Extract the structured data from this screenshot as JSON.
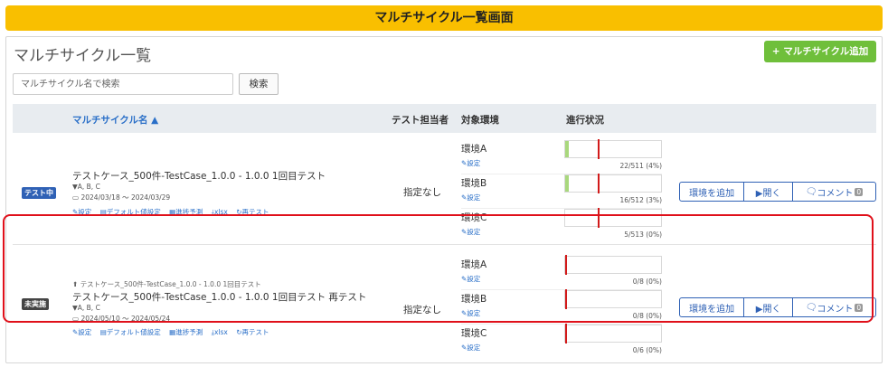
{
  "banner": {
    "title": "マルチサイクル一覧画面"
  },
  "panel": {
    "title": "マルチサイクル一覧",
    "add_button": "+ マルチサイクル追加",
    "search_placeholder": "マルチサイクル名で検索",
    "search_button": "検索"
  },
  "table": {
    "headers": {
      "name": "マルチサイクル名 ▲",
      "assignee": "テスト担当者",
      "env": "対象環境",
      "progress": "進行状況"
    },
    "rows": [
      {
        "status": "テスト中",
        "status_color": "#2f61b5",
        "parent": "",
        "name": "テストケース_500件-TestCase_1.0.0 - 1.0.0 1回目テスト",
        "filter": "▼A, B, C",
        "dates": "2024/03/18 ～ 2024/03/29",
        "links": [
          "設定",
          "デフォルト値設定",
          "進捗予測",
          "xlsx",
          "再テスト"
        ],
        "assignee": "指定なし",
        "envs": [
          {
            "name": "環境A",
            "setting": "設定",
            "progress": "22/511 (4%)",
            "ratio": 0.04
          },
          {
            "name": "環境B",
            "setting": "設定",
            "progress": "16/512 (3%)",
            "ratio": 0.03
          },
          {
            "name": "環境C",
            "setting": "設定",
            "progress": "5/513 (0%)",
            "ratio": 0.0
          }
        ],
        "actions": {
          "add_env": "環境を追加",
          "open": "▶開く",
          "comment": "コメント",
          "comment_count": "0"
        }
      },
      {
        "status": "未実施",
        "status_color": "#444444",
        "parent": "テストケース_500件-TestCase_1.0.0 - 1.0.0 1回目テスト",
        "name": "テストケース_500件-TestCase_1.0.0 - 1.0.0 1回目テスト 再テスト",
        "filter": "▼A, B, C",
        "dates": "2024/05/10 ～ 2024/05/24",
        "links": [
          "設定",
          "デフォルト値設定",
          "進捗予測",
          "xlsx",
          "再テスト"
        ],
        "assignee": "指定なし",
        "envs": [
          {
            "name": "環境A",
            "setting": "設定",
            "progress": "0/8 (0%)",
            "ratio": 0.0
          },
          {
            "name": "環境B",
            "setting": "設定",
            "progress": "0/8 (0%)",
            "ratio": 0.0
          },
          {
            "name": "環境C",
            "setting": "設定",
            "progress": "0/6 (0%)",
            "ratio": 0.0
          }
        ],
        "actions": {
          "add_env": "環境を追加",
          "open": "▶開く",
          "comment": "コメント",
          "comment_count": "0"
        }
      }
    ]
  },
  "colors": {
    "banner": "#f9bf00",
    "add_button": "#6fbf3b",
    "progress_fill": "#a9d87d",
    "marker": "#d21a1a",
    "highlight": "#e0101a"
  }
}
